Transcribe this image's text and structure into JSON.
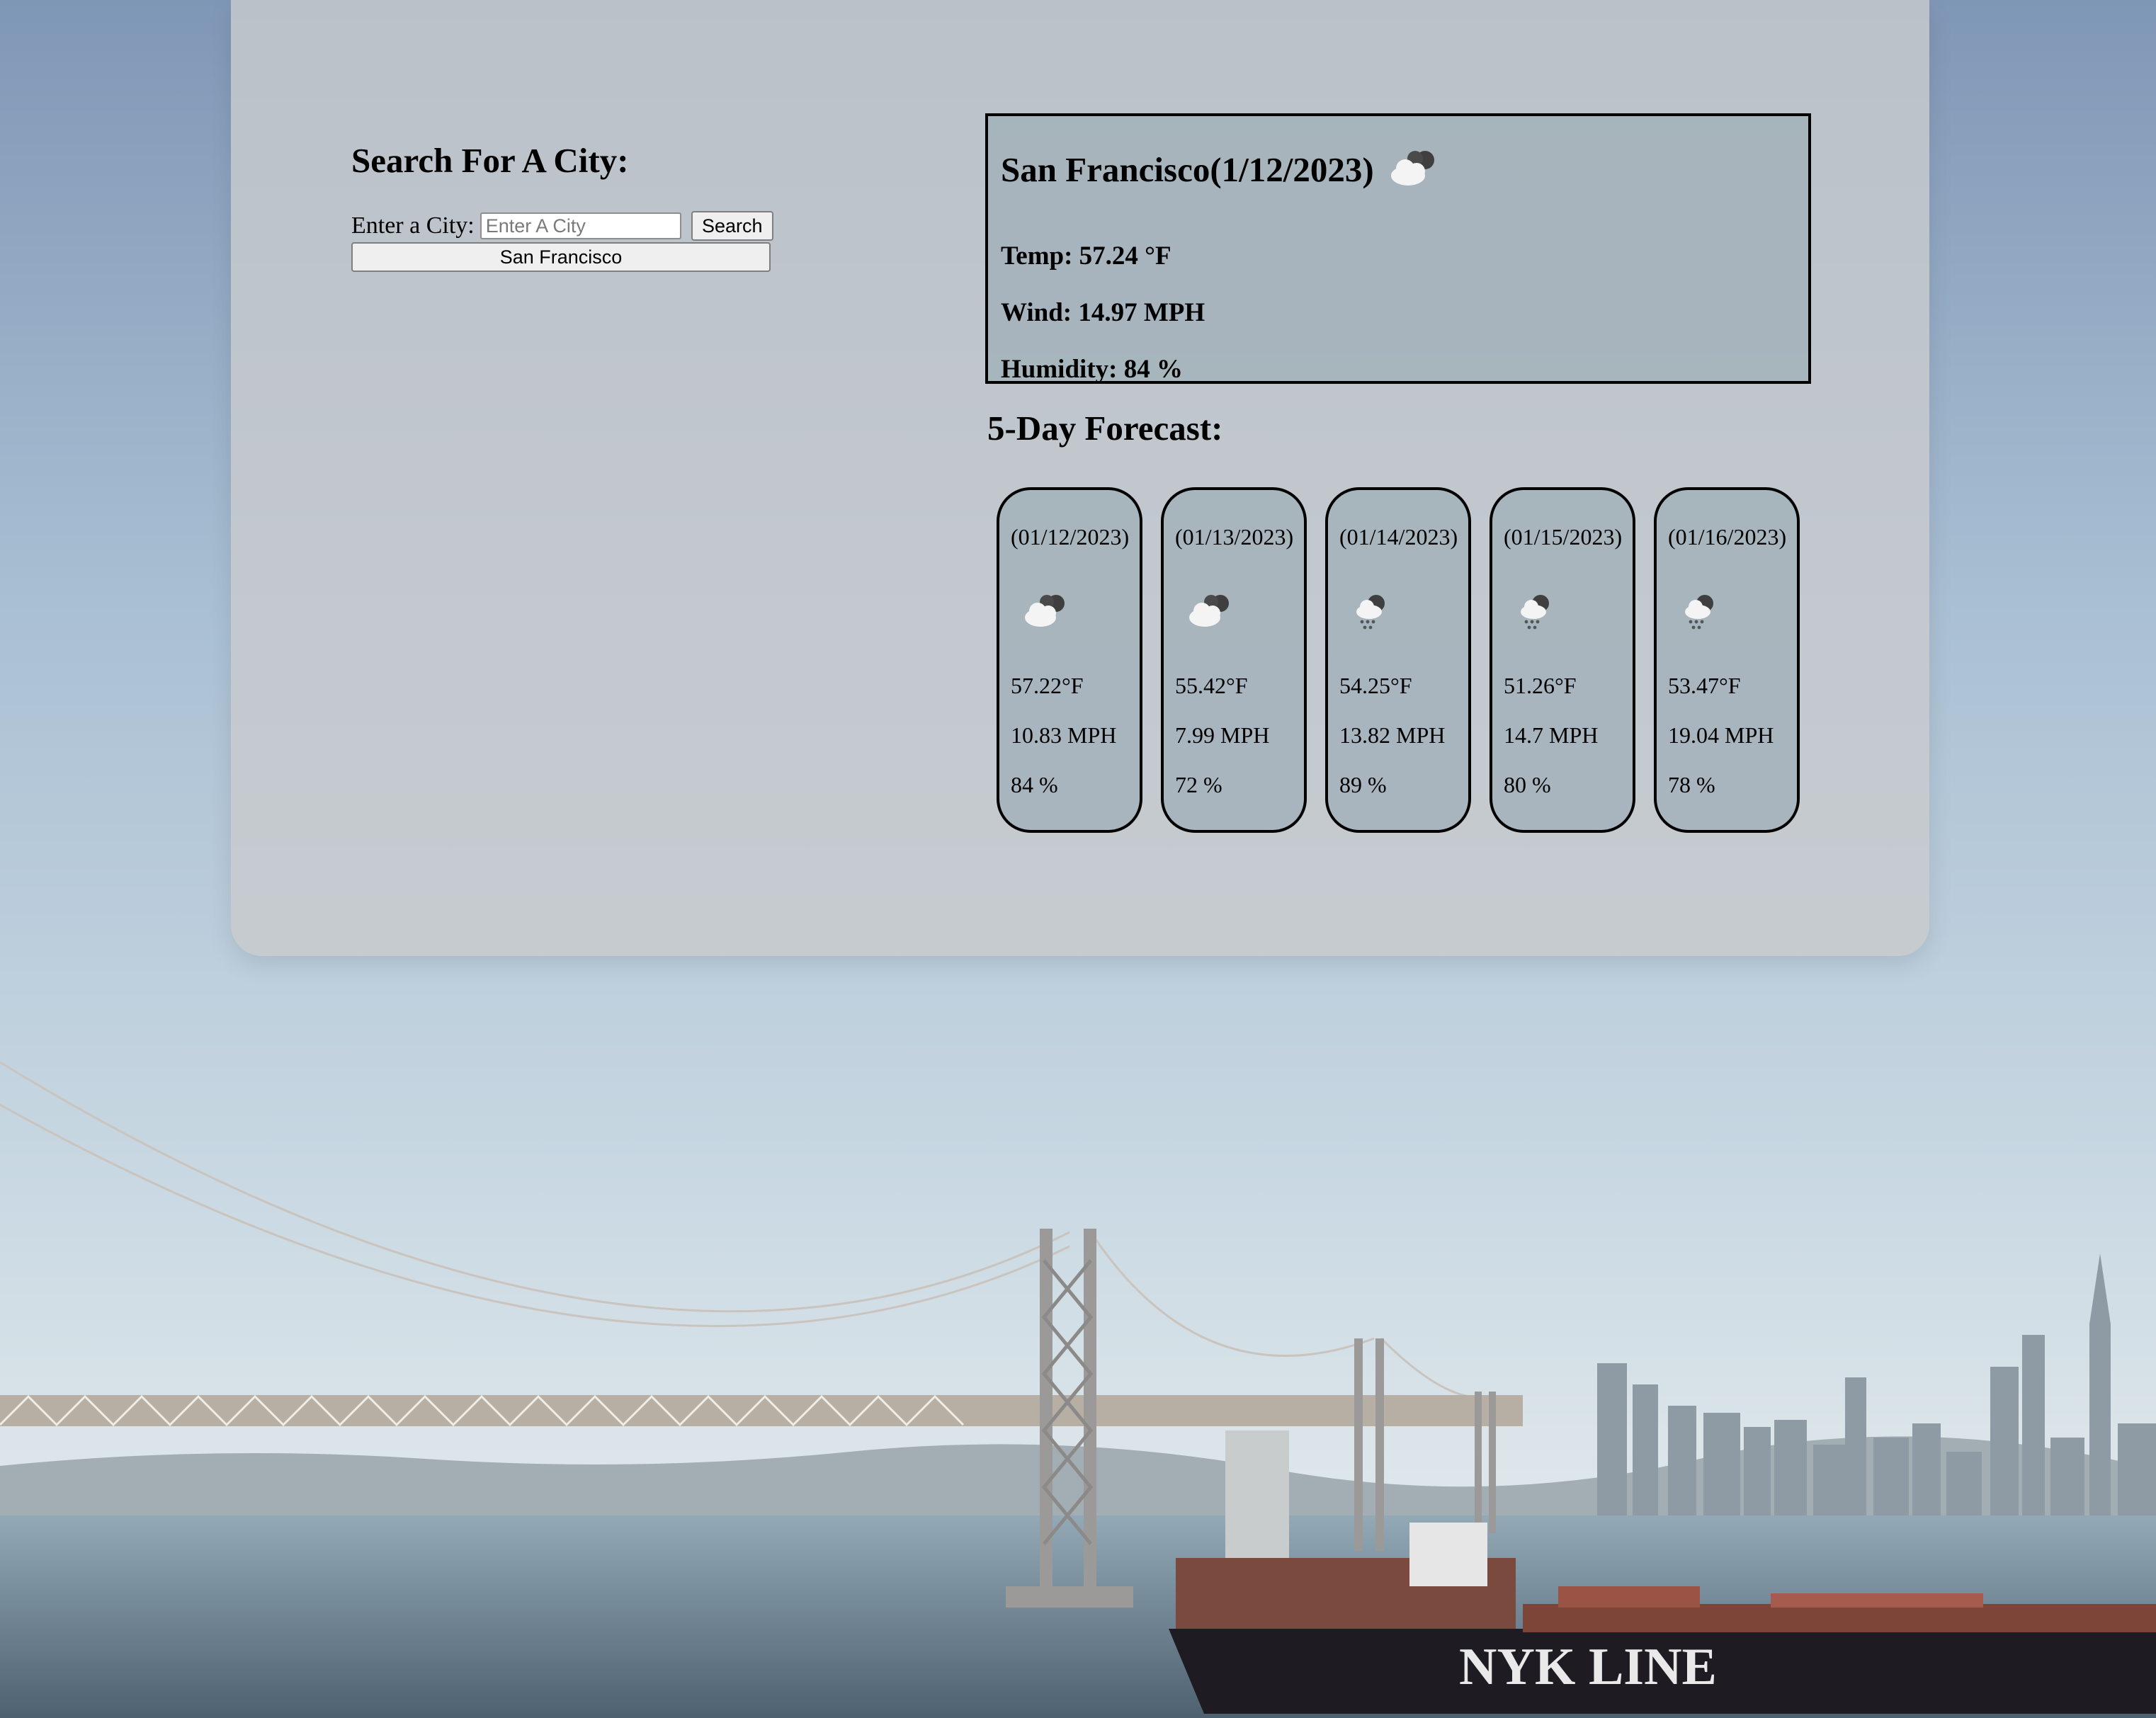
{
  "search": {
    "title": "Search For A City:",
    "label": "Enter a City:",
    "placeholder": "Enter A City",
    "value": "",
    "button_label": "Search",
    "history": [
      "San Francisco"
    ]
  },
  "current": {
    "title": "San Francisco(1/12/2023)",
    "icon": "cloud-icon",
    "temp": "Temp: 57.24 °F",
    "wind": "Wind: 14.97 MPH",
    "humidity": "Humidity: 84 %"
  },
  "forecast": {
    "title": "5-Day Forecast:",
    "days": [
      {
        "date": "(01/12/2023)",
        "icon": "cloud-icon",
        "temp": "57.22°F",
        "wind": "10.83 MPH",
        "humidity": "84 %"
      },
      {
        "date": "(01/13/2023)",
        "icon": "cloud-icon",
        "temp": "55.42°F",
        "wind": "7.99 MPH",
        "humidity": "72 %"
      },
      {
        "date": "(01/14/2023)",
        "icon": "rain-cloud-icon",
        "temp": "54.25°F",
        "wind": "13.82 MPH",
        "humidity": "89 %"
      },
      {
        "date": "(01/15/2023)",
        "icon": "rain-cloud-icon",
        "temp": "51.26°F",
        "wind": "14.7 MPH",
        "humidity": "80 %"
      },
      {
        "date": "(01/16/2023)",
        "icon": "rain-cloud-icon",
        "temp": "53.47°F",
        "wind": "19.04 MPH",
        "humidity": "78 %"
      }
    ]
  },
  "background": {
    "ship_lettering": "NYK LINE"
  }
}
